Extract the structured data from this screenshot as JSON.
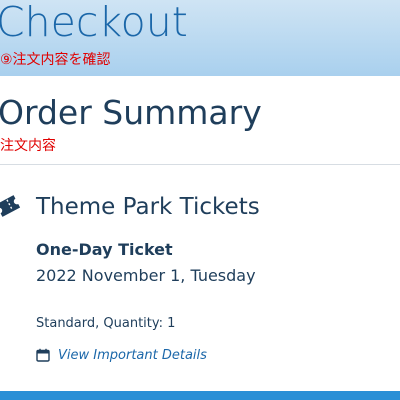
{
  "header": {
    "title": "Checkout",
    "annotation": "⑨注文内容を確認"
  },
  "summary": {
    "title": "Order Summary",
    "annotation": "注文内容"
  },
  "product": {
    "icon": "ticket-icon",
    "title": "Theme Park Tickets",
    "ticket_type": "One-Day Ticket",
    "date": "2022 November 1, Tuesday",
    "quantity_text": "Standard, Quantity: 1",
    "details_link": {
      "icon": "calendar-icon",
      "label": "View Important Details"
    }
  },
  "colors": {
    "header_text": "#1b67a9",
    "body_text": "#1f3e5b",
    "annotation": "#e00000",
    "link": "#1b67a9",
    "bottom_bar": "#2a8fd6"
  }
}
